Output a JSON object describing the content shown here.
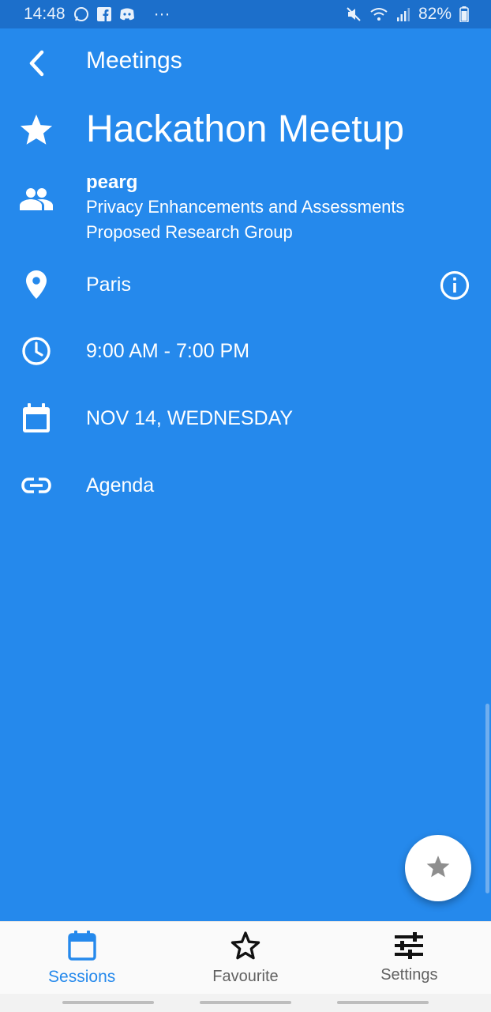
{
  "status_bar": {
    "time": "14:48",
    "more": "···",
    "battery": "82%",
    "icons": [
      "whatsapp-icon",
      "facebook-icon",
      "discord-icon",
      "mute-icon",
      "wifi-icon",
      "signal-icon",
      "battery-icon"
    ]
  },
  "app_bar": {
    "back_icon": "chevron-left-icon",
    "title": "Meetings"
  },
  "meeting": {
    "title": "Hackathon Meetup",
    "group_name": "pearg",
    "group_description": "Privacy Enhancements and Assessments Proposed Research Group",
    "location": "Paris",
    "time": "9:00 AM - 7:00 PM",
    "date": "NOV 14, WEDNESDAY",
    "agenda": "Agenda"
  },
  "bottom_nav": {
    "items": [
      {
        "label": "Sessions",
        "icon": "calendar-icon",
        "active": true
      },
      {
        "label": "Favourite",
        "icon": "star-outline-icon",
        "active": false
      },
      {
        "label": "Settings",
        "icon": "sliders-icon",
        "active": false
      }
    ]
  },
  "colors": {
    "background": "#2589EC",
    "status_bar": "#1C6FCB",
    "accent": "#2589EC",
    "nav_bg": "#FAFAFA"
  }
}
